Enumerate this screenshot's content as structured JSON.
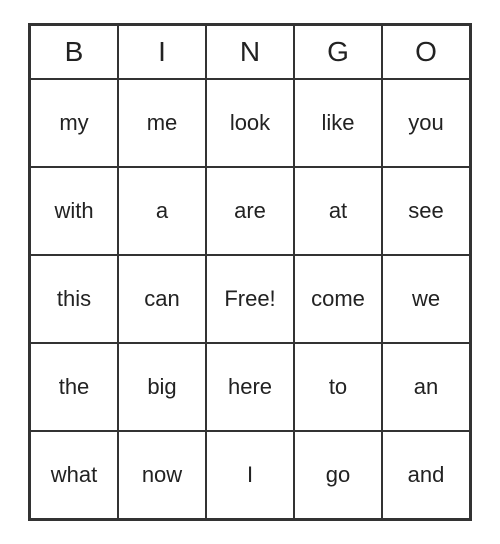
{
  "header": {
    "letters": [
      "B",
      "I",
      "N",
      "G",
      "O"
    ]
  },
  "grid": [
    [
      "my",
      "me",
      "look",
      "like",
      "you"
    ],
    [
      "with",
      "a",
      "are",
      "at",
      "see"
    ],
    [
      "this",
      "can",
      "Free!",
      "come",
      "we"
    ],
    [
      "the",
      "big",
      "here",
      "to",
      "an"
    ],
    [
      "what",
      "now",
      "I",
      "go",
      "and"
    ]
  ]
}
